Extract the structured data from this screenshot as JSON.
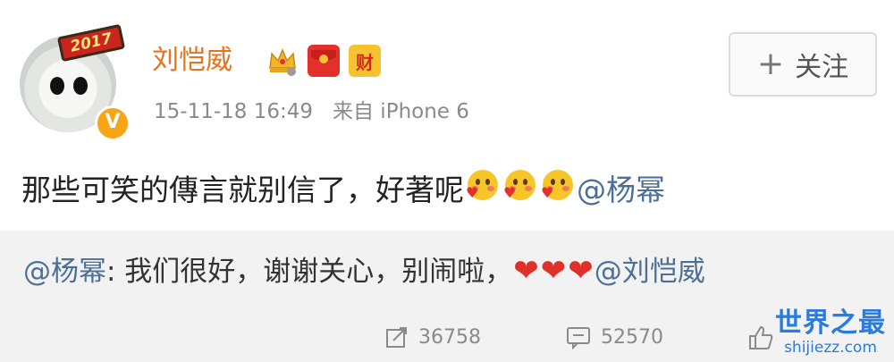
{
  "post": {
    "user_name": "刘恺威",
    "avatar_tag_text": "2017",
    "verified_symbol": "V",
    "badges": [
      {
        "name": "crown-badge",
        "icon": "crown-icon"
      },
      {
        "name": "red-packet-badge",
        "icon": "red-packet-icon"
      },
      {
        "name": "wealth-badge",
        "label": "财"
      }
    ],
    "timestamp": "15-11-18 16:49",
    "source": "来自 iPhone 6",
    "follow_button": {
      "plus": "+",
      "label": "关注"
    },
    "text": "那些可笑的傳言就别信了，好著呢",
    "emoji_count": 3,
    "mention": "@杨幂"
  },
  "repost": {
    "mention": "@杨幂",
    "text": ": 我们很好，谢谢关心，别闹啦，",
    "heart_count": 3,
    "end_mention": "@刘恺威"
  },
  "actions": {
    "repost_count": "36758",
    "comment_count": "52570"
  },
  "watermark": {
    "title": "世界之最",
    "url": "shijiezz.com"
  },
  "colors": {
    "username": "#e8731a",
    "mention": "#4c6f96",
    "heart": "#e0302a",
    "watermark": "#2a7be0"
  }
}
